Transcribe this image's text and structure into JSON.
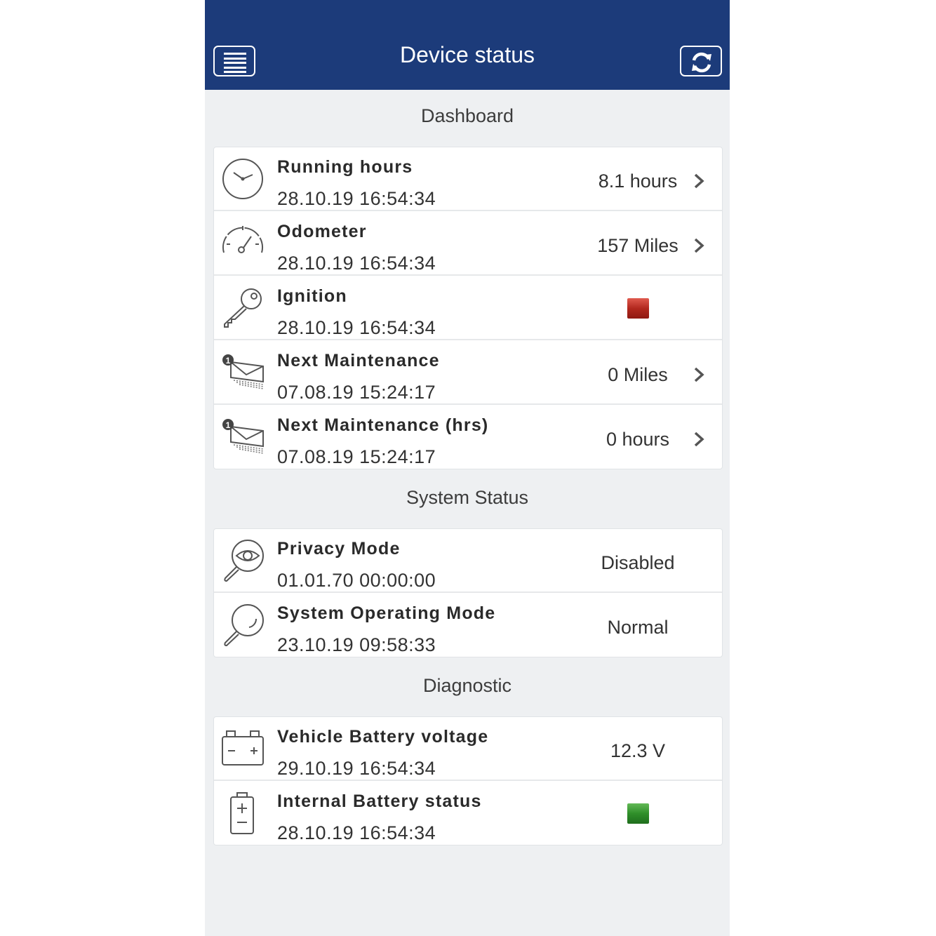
{
  "header": {
    "title": "Device status",
    "menu_icon": "menu-icon",
    "refresh_icon": "refresh-icon"
  },
  "sections": [
    {
      "title": "Dashboard",
      "rows": [
        {
          "label": "Running hours",
          "time": "28.10.19 16:54:34",
          "value": "8.1 hours",
          "icon": "clock-icon",
          "chevron": true
        },
        {
          "label": "Odometer",
          "time": "28.10.19 16:54:34",
          "value": "157 Miles",
          "icon": "speedometer-icon",
          "chevron": true
        },
        {
          "label": "Ignition",
          "time": "28.10.19 16:54:34",
          "indicator": "red",
          "icon": "key-icon",
          "chevron": false
        },
        {
          "label": "Next Maintenance",
          "time": "07.08.19 15:24:17",
          "value": "0 Miles",
          "icon": "mail-badge-icon",
          "chevron": true
        },
        {
          "label": "Next Maintenance (hrs)",
          "time": "07.08.19 15:24:17",
          "value": "0 hours",
          "icon": "mail-badge-icon",
          "chevron": true
        }
      ]
    },
    {
      "title": "System Status",
      "rows": [
        {
          "label": "Privacy Mode",
          "time": "01.01.70 00:00:00",
          "value": "Disabled",
          "icon": "magnifier-eye-icon",
          "chevron": false
        },
        {
          "label": "System Operating Mode",
          "time": "23.10.19 09:58:33",
          "value": "Normal",
          "icon": "magnifier-icon",
          "chevron": false
        }
      ]
    },
    {
      "title": "Diagnostic",
      "rows": [
        {
          "label": "Vehicle Battery voltage",
          "time": "29.10.19 16:54:34",
          "value": "12.3 V",
          "icon": "car-battery-icon",
          "chevron": false
        },
        {
          "label": "Internal Battery status",
          "time": "28.10.19 16:54:34",
          "indicator": "green",
          "icon": "battery-icon",
          "chevron": false
        }
      ]
    }
  ],
  "colors": {
    "header": "#1c3b7a",
    "background": "#eef0f2",
    "indicator_red": "#b2281e",
    "indicator_green": "#2f8f2a"
  }
}
